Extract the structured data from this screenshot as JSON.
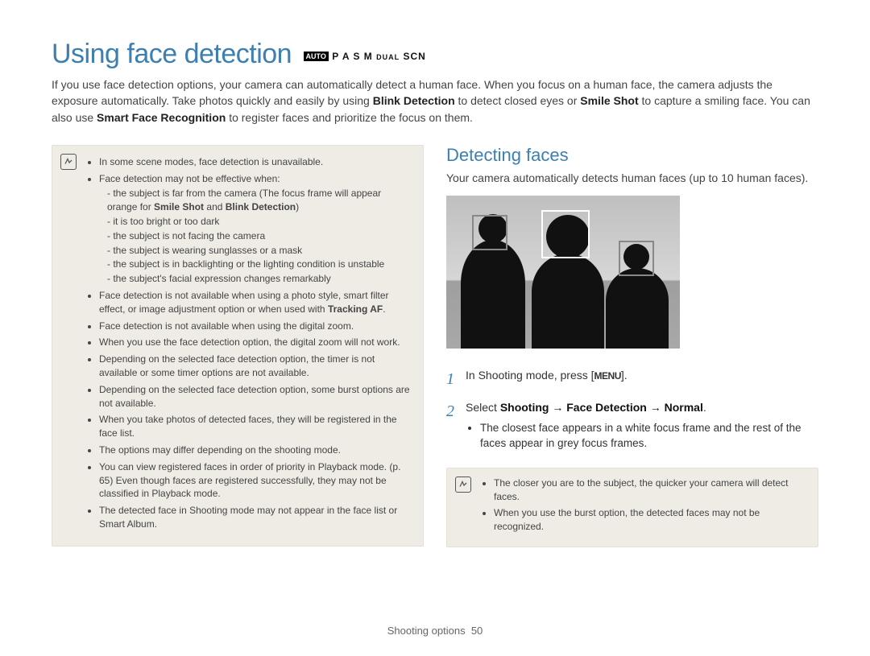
{
  "title": "Using face detection",
  "mode_row": {
    "auto": "AUTO",
    "modes": "P A S M",
    "dual": "DUAL",
    "scn": "SCN"
  },
  "intro": {
    "part1": "If you use face detection options, your camera can automatically detect a human face. When you focus on a human face, the camera adjusts the exposure automatically. Take photos quickly and easily by using ",
    "bold1": "Blink Detection",
    "part2": " to detect closed eyes or ",
    "bold2": "Smile Shot",
    "part3": " to capture a smiling face. You can also use ",
    "bold3": "Smart Face Recognition",
    "part4": " to register faces and prioritize the focus on them."
  },
  "note_left": {
    "b1": "In some scene modes, face detection is unavailable.",
    "b2": "Face detection may not be effective when:",
    "d1_a": "the subject is far from the camera (The focus frame will appear orange for ",
    "d1_bold1": "Smile Shot",
    "d1_mid": " and ",
    "d1_bold2": "Blink Detection",
    "d1_b": ")",
    "d2": "it is too bright or too dark",
    "d3": "the subject is not facing the camera",
    "d4": "the subject is wearing sunglasses or a mask",
    "d5": "the subject is in backlighting or the lighting condition is unstable",
    "d6": "the subject's facial expression changes remarkably",
    "b3_a": "Face detection is not available when using a photo style, smart filter effect, or image adjustment option or when used with ",
    "b3_bold": "Tracking AF",
    "b3_b": ".",
    "b4": "Face detection is not available when using the digital zoom.",
    "b5": "When you use the face detection option, the digital zoom will not work.",
    "b6": "Depending on the selected face detection option, the timer is not available or some timer options are not available.",
    "b7": "Depending on the selected face detection option, some burst options are not available.",
    "b8": "When you take photos of detected faces, they will be registered in the face list.",
    "b9": "The options may differ depending on the shooting mode.",
    "b10": "You can view registered faces in order of priority in Playback mode. (p. 65) Even though faces are registered successfully, they may not be classified in Playback mode.",
    "b11": "The detected face in Shooting mode may not appear in the face list or Smart Album."
  },
  "section": {
    "title": "Detecting faces",
    "intro": "Your camera automatically detects human faces (up to 10 human faces)."
  },
  "steps": {
    "s1_a": "In Shooting mode, press [",
    "s1_menu": "MENU",
    "s1_b": "].",
    "s2_a": "Select ",
    "s2_bold": "Shooting → Face Detection → Normal",
    "s2_b": ".",
    "s2_sub": "The closest face appears in a white focus frame and the rest of the faces appear in grey focus frames."
  },
  "note_right": {
    "b1": "The closer you are to the subject, the quicker your camera will detect faces.",
    "b2": "When you use the burst option, the detected faces may not be recognized."
  },
  "footer": {
    "section": "Shooting options",
    "page": "50"
  }
}
